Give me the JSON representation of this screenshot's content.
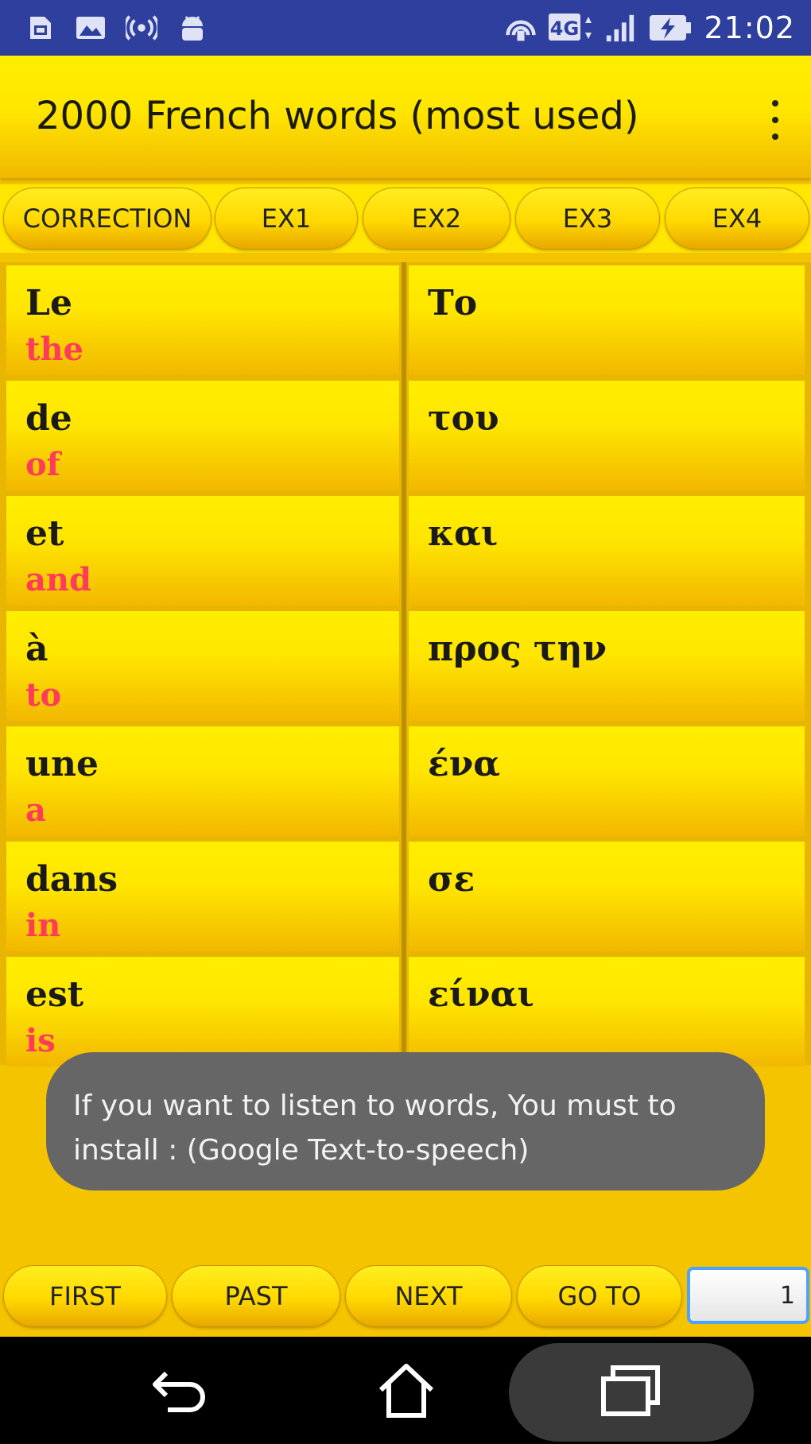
{
  "status_bar": {
    "time": "21:02",
    "left_icons": [
      "sim-card-icon",
      "image-icon",
      "broadcast-icon",
      "android-icon"
    ],
    "right_icons": [
      "hotspot-icon",
      "network-4g-icon",
      "signal-icon",
      "battery-charging-icon"
    ],
    "network_label": "4G",
    "background_color": "#2e3f9e"
  },
  "app_bar": {
    "title": "2000 French words (most used)",
    "menu_icon": "more-vert-icon"
  },
  "tabs": [
    {
      "label": "CORRECTION"
    },
    {
      "label": "EX1"
    },
    {
      "label": "EX2"
    },
    {
      "label": "EX3"
    },
    {
      "label": "EX4"
    }
  ],
  "words": [
    {
      "french": "Le",
      "english": "the",
      "greek": "Το"
    },
    {
      "french": "de",
      "english": "of",
      "greek": "του"
    },
    {
      "french": "et",
      "english": "and",
      "greek": "και"
    },
    {
      "french": "à",
      "english": "to",
      "greek": "προς την"
    },
    {
      "french": "une",
      "english": "a",
      "greek": "ένα"
    },
    {
      "french": "dans",
      "english": "in",
      "greek": "σε"
    },
    {
      "french": "est",
      "english": "is",
      "greek": "είναι"
    }
  ],
  "toast": {
    "message": "If you want to listen to words, You must to install : (Google Text-to-speech)"
  },
  "bottom_nav": {
    "first_label": "FIRST",
    "past_label": "PAST",
    "next_label": "NEXT",
    "goto_label": "GO TO",
    "page_value": "1"
  },
  "system_nav": {
    "icons": [
      "back-icon",
      "home-icon",
      "recents-icon"
    ]
  },
  "colors": {
    "accent_yellow": "#ffe600",
    "english_text": "#ff3b5c",
    "status_bar": "#2e3f9e",
    "toast_bg": "#666666"
  }
}
